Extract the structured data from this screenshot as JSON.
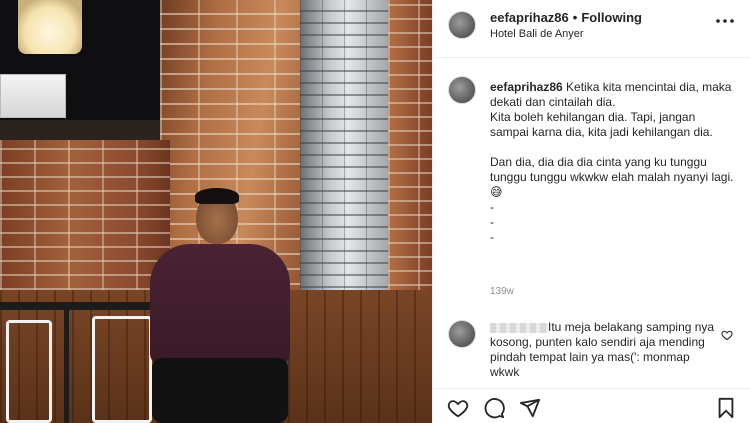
{
  "post": {
    "username": "eefaprihaz86",
    "separator": "•",
    "follow_status": "Following",
    "location": "Hotel Bali de Anyer"
  },
  "caption": {
    "username": "eefaprihaz86",
    "text": "Ketika kita mencintai dia, maka dekati dan cintailah dia.\nKita boleh kehilangan dia. Tapi, jangan sampai karna dia, kita jadi kehilangan dia.\n\nDan dia, dia dia dia cinta yang ku tunggu tunggu tunggu wkwkw elah malah nyanyi lagi.😅\n-\n-\n-",
    "timestamp": "139w"
  },
  "comment": {
    "text": "Itu meja belakang samping nya kosong, punten kalo sendiri aja mending pindah tempat lain ya mas(': monmap wkwk"
  },
  "icons": {
    "more": "more-options-icon",
    "like": "heart-icon",
    "comment": "comment-icon",
    "share": "share-icon",
    "save": "bookmark-icon",
    "comment_like": "heart-icon"
  },
  "colors": {
    "text": "#262626",
    "secondary": "#8e8e8e",
    "border": "#efefef"
  }
}
